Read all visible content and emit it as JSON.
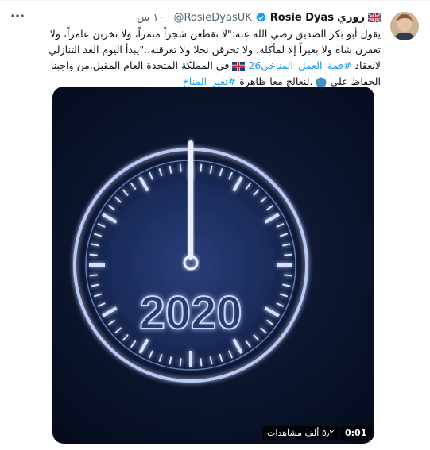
{
  "author": {
    "name_ar": "روري",
    "name_en": "Rosie Dyas",
    "handle": "@RosieDyasUK",
    "time": "١٠ س",
    "flag": "uk-flag",
    "verified": true
  },
  "tweet": {
    "line1": "يقول أبو بكر الصديق رضي الله عنه:\"لا تقطعن شجراً متمراً، ولا تخربن عامراً، ولا",
    "line2": "تعقرن شاة ولا بعيراً إلا لمأكلة، ولا تحرقن نخلا ولا تغرقنه..\"يبدأ اليوم العد التنازلي",
    "line3_before": "لانعقاد",
    "hashtag1": "#قمة_العمل_المناخي26",
    "line3_after": "في المملكة المتحدة العام المقبل.من واجبنا",
    "line4_before": "الحفاظ على",
    "line4_after": ".لنعالج معا ظاهرة",
    "hashtag2": "#تغير_المناخ"
  },
  "media": {
    "year": "2020",
    "views": "٥٫٢ ألف مشاهدات",
    "duration": "0:01"
  },
  "colors": {
    "accent": "#1d9bf0",
    "text": "#0f1419",
    "muted": "#536471",
    "glow": "#b9c8f5"
  },
  "icons": [
    "uk-flag-icon",
    "verified-icon",
    "more-icon",
    "globe-icon"
  ]
}
